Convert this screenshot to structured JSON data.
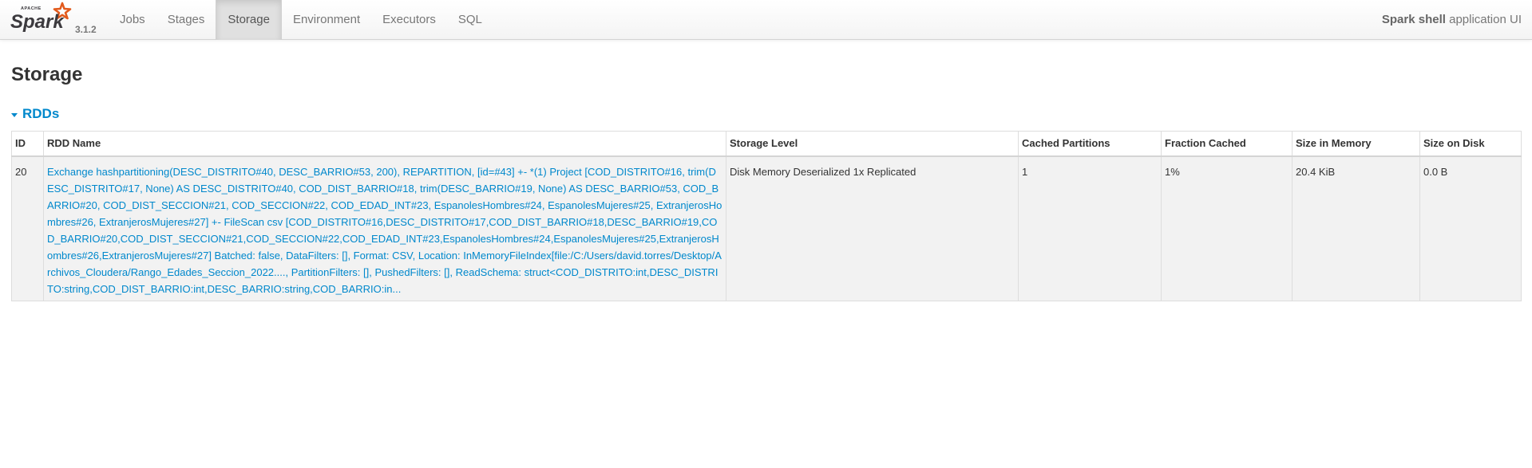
{
  "navbar": {
    "brand_apache": "APACHE",
    "brand_name": "Spark",
    "version": "3.1.2",
    "tabs": [
      {
        "label": "Jobs",
        "active": false
      },
      {
        "label": "Stages",
        "active": false
      },
      {
        "label": "Storage",
        "active": true
      },
      {
        "label": "Environment",
        "active": false
      },
      {
        "label": "Executors",
        "active": false
      },
      {
        "label": "SQL",
        "active": false
      }
    ],
    "app_name": "Spark shell",
    "app_suffix": "application UI"
  },
  "page": {
    "title": "Storage",
    "section_label": "RDDs"
  },
  "table": {
    "headers": {
      "id": "ID",
      "rdd_name": "RDD Name",
      "storage_level": "Storage Level",
      "cached_partitions": "Cached Partitions",
      "fraction_cached": "Fraction Cached",
      "size_in_memory": "Size in Memory",
      "size_on_disk": "Size on Disk"
    },
    "rows": [
      {
        "id": "20",
        "rdd_name": "Exchange hashpartitioning(DESC_DISTRITO#40, DESC_BARRIO#53, 200), REPARTITION, [id=#43] +- *(1) Project [COD_DISTRITO#16, trim(DESC_DISTRITO#17, None) AS DESC_DISTRITO#40, COD_DIST_BARRIO#18, trim(DESC_BARRIO#19, None) AS DESC_BARRIO#53, COD_BARRIO#20, COD_DIST_SECCION#21, COD_SECCION#22, COD_EDAD_INT#23, EspanolesHombres#24, EspanolesMujeres#25, ExtranjerosHombres#26, ExtranjerosMujeres#27] +- FileScan csv [COD_DISTRITO#16,DESC_DISTRITO#17,COD_DIST_BARRIO#18,DESC_BARRIO#19,COD_BARRIO#20,COD_DIST_SECCION#21,COD_SECCION#22,COD_EDAD_INT#23,EspanolesHombres#24,EspanolesMujeres#25,ExtranjerosHombres#26,ExtranjerosMujeres#27] Batched: false, DataFilters: [], Format: CSV, Location: InMemoryFileIndex[file:/C:/Users/david.torres/Desktop/Archivos_Cloudera/Rango_Edades_Seccion_2022...., PartitionFilters: [], PushedFilters: [], ReadSchema: struct<COD_DISTRITO:int,DESC_DISTRITO:string,COD_DIST_BARRIO:int,DESC_BARRIO:string,COD_BARRIO:in...",
        "storage_level": "Disk Memory Deserialized 1x Replicated",
        "cached_partitions": "1",
        "fraction_cached": "1%",
        "size_in_memory": "20.4 KiB",
        "size_on_disk": "0.0 B"
      }
    ]
  },
  "colors": {
    "link": "#0088cc",
    "spark_orange": "#e25a1c",
    "spark_text": "#3c3a3e",
    "row_bg": "#f2f2f2"
  },
  "icons": {
    "logo": "spark-star-logo",
    "section_toggle": "caret-down-icon"
  }
}
